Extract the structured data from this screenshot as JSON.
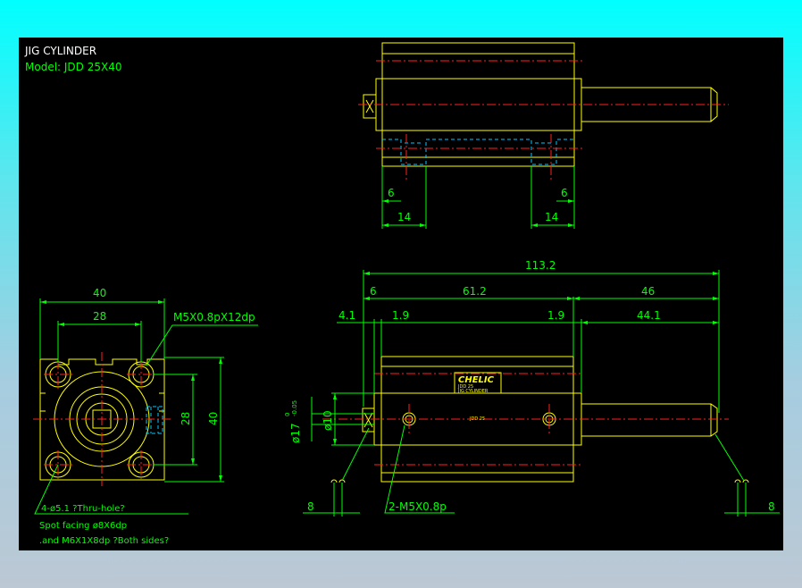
{
  "title": {
    "line1": "JIG  CYLINDER",
    "line2": "Model:  JDD  25X40"
  },
  "front_view": {
    "dims": {
      "width_40": "40",
      "width_28": "28",
      "height_28": "28",
      "height_40": "40"
    },
    "callout_thread": "M5X0.8pX12dp",
    "note": {
      "line1": "4-ø5.1 ?Thru-hole?",
      "line2": "Spot facing  ø8X6dp",
      "line3": ".and  M6X1X8dp ?Both sides?"
    }
  },
  "top_view": {
    "dims": {
      "left_6": "6",
      "right_6": "6",
      "left_14": "14",
      "right_14": "14"
    }
  },
  "side_view": {
    "dims": {
      "overall": "113.2",
      "d6": "6",
      "d61_2": "61.2",
      "d46": "46",
      "d4_1": "4.1",
      "d1_9_left": "1.9",
      "d1_9_right": "1.9",
      "d44_1": "44.1",
      "dia10": "ø10",
      "dia17": "ø17",
      "dia17_tol_upper": "0",
      "dia17_tol_lower": "-0.05",
      "left_8": "8",
      "right_8": "8"
    },
    "port_callout": "2-M5X0.8p",
    "label": {
      "brand": "CHELIC",
      "line1": "JDD 25",
      "line2": "JIG CYLINDER"
    },
    "body_mark": "JDD 25"
  },
  "colors": {
    "background": "#000000",
    "outline": "#ffff00",
    "dimension": "#00ff00",
    "center_line": "#ff2020",
    "hidden_line": "#00c8ff",
    "text": "#ffffff"
  }
}
